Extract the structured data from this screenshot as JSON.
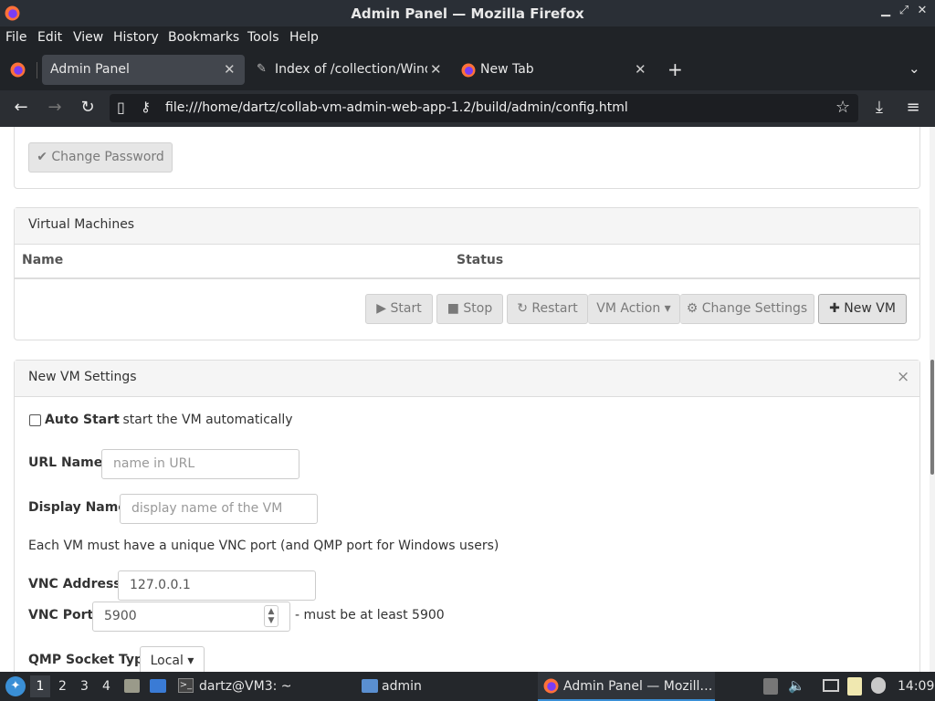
{
  "window": {
    "title": "Admin Panel — Mozilla Firefox"
  },
  "menu": [
    "File",
    "Edit",
    "View",
    "History",
    "Bookmarks",
    "Tools",
    "Help"
  ],
  "tabs": [
    {
      "label": "Admin Panel"
    },
    {
      "label": "Index of /collection/Windo"
    },
    {
      "label": "New Tab"
    }
  ],
  "nav": {
    "url": "file:///home/dartz/collab-vm-admin-web-app-1.2/build/admin/config.html"
  },
  "page": {
    "change_password": "✔ Change Password",
    "vms_heading": "Virtual Machines",
    "col_name": "Name",
    "col_status": "Status",
    "buttons": {
      "start": "▶ Start",
      "stop": "■ Stop",
      "restart": "↻ Restart",
      "vm_action": "VM Action ▾",
      "change_settings": "⚙ Change Settings",
      "new_vm": "✚ New VM"
    },
    "new_vm_heading": "New VM Settings",
    "close": "×",
    "auto_start_label": "Auto Start",
    "auto_start_desc": " - start the VM automatically",
    "url_name_label": "URL Name:",
    "url_name_placeholder": "name in URL",
    "display_name_label": "Display Name:",
    "display_name_placeholder": "display name of the VM",
    "vnc_note": "Each VM must have a unique VNC port (and QMP port for Windows users)",
    "vnc_address_label": "VNC Address:",
    "vnc_address_value": "127.0.0.1",
    "vnc_port_label": "VNC Port:",
    "vnc_port_value": "5900",
    "vnc_port_note": "- must be at least 5900",
    "qmp_label": "QMP Socket Type:",
    "qmp_value": "Local ▾"
  },
  "taskbar": {
    "workspaces": [
      "1",
      "2",
      "3",
      "4"
    ],
    "terminal": "dartz@VM3: ~",
    "files": "admin",
    "firefox": "Admin Panel — Mozill…",
    "clock": "14:09"
  },
  "colors": {
    "chrome_dark": "#202327",
    "panel_heading": "#f5f5f5"
  }
}
